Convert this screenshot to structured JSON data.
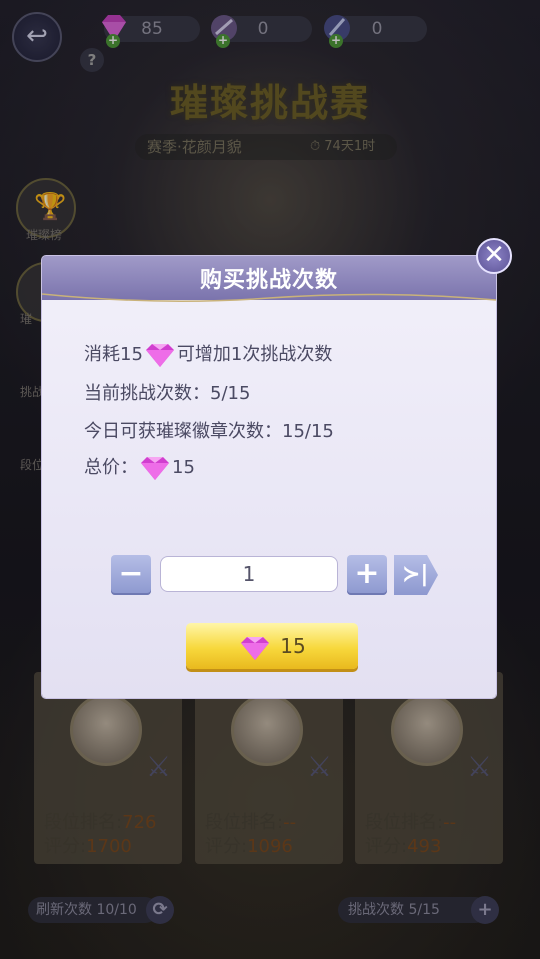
{
  "top_bar": {
    "resources": [
      {
        "icon": "gem-icon",
        "value": "85"
      },
      {
        "icon": "ticket-icon",
        "value": "0"
      },
      {
        "icon": "quill-icon",
        "value": "0"
      }
    ],
    "help_label": "?"
  },
  "event": {
    "title": "璀璨挑战赛",
    "season": "赛季·花颜月貌",
    "countdown": "74天1时"
  },
  "side_menu": [
    {
      "label": "璀璨榜"
    },
    {
      "label": "璀"
    },
    {
      "label": "挑战"
    },
    {
      "label": "段位"
    }
  ],
  "cards": [
    {
      "rank_label": "段位排名:",
      "rank": "726",
      "score_label": "评分:",
      "score": "1700"
    },
    {
      "rank_label": "段位排名:",
      "rank": "--",
      "score_label": "评分:",
      "score": "1096"
    },
    {
      "rank_label": "段位排名:",
      "rank": "--",
      "score_label": "评分:",
      "score": "493"
    }
  ],
  "bottom": {
    "refresh": "刷新次数 10/10",
    "challenge": "挑战次数 5/15"
  },
  "dialog": {
    "title": "购买挑战次数",
    "cost_prefix": "消耗15",
    "cost_suffix": "可增加1次挑战次数",
    "current_challenges": "当前挑战次数：5/15",
    "badge_today": "今日可获璀璨徽章次数：15/15",
    "total_label": "总价：",
    "total_value": "15",
    "quantity": "1",
    "buy_price": "15",
    "minus_label": "−",
    "plus_label": "+",
    "max_label": "≻|"
  },
  "colors": {
    "gem": "#e64bd6",
    "buy_button": "#f7d83c",
    "dialog_header": "#8b84ba"
  }
}
